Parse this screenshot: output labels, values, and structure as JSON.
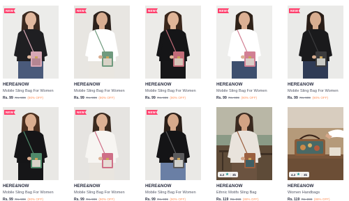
{
  "products": [
    {
      "badge": "NEW",
      "brand": "HERE&NOW",
      "title": "Mobile Sling Bag For Women",
      "price": "Rs. 99",
      "mrp": "Rs. 999",
      "off": "(90% OFF)",
      "scene": {
        "bg": "#ececea",
        "top": "#1f1f22",
        "skin": "#e2b99f",
        "hair": "#3b2a20",
        "bag": "#d7a7b5",
        "bag2": "#b58692",
        "bottom": "#4a5a7a"
      }
    },
    {
      "badge": "NEW",
      "brand": "HERE&NOW",
      "title": "Mobile Sling Bag For Women",
      "price": "Rs. 99",
      "mrp": "Rs. 999",
      "off": "(90% OFF)",
      "scene": {
        "bg": "#e8e6e2",
        "top": "#ffffff",
        "skin": "#d9ae92",
        "hair": "#2c211b",
        "bag": "#6f9a7e",
        "bag2": "#d8d2c6",
        "bottom": "#e9e6e0"
      }
    },
    {
      "badge": "NEW",
      "brand": "HERE&NOW",
      "title": "Mobile Sling Bag For Women",
      "price": "Rs. 99",
      "mrp": "Rs. 999",
      "off": "(90% OFF)",
      "scene": {
        "bg": "#ecebe8",
        "top": "#151517",
        "skin": "#e0b598",
        "hair": "#3a271c",
        "bag": "#c26b78",
        "bag2": "#d6c4b8",
        "bottom": "#161618"
      }
    },
    {
      "badge": "NEW",
      "brand": "HERE&NOW",
      "title": "Mobile Sling Bag For Women",
      "price": "Rs. 99",
      "mrp": "Rs. 999",
      "off": "(90% OFF)",
      "scene": {
        "bg": "#eeeeec",
        "top": "#ffffff",
        "skin": "#dcb094",
        "hair": "#2f2219",
        "bag": "#d27f93",
        "bag2": "#d9ccc6",
        "bottom": "#3d4f6e"
      }
    },
    {
      "badge": "NEW",
      "brand": "HERE&NOW",
      "title": "Mobile Sling Bag For Women",
      "price": "Rs. 99",
      "mrp": "Rs. 999",
      "off": "(90% OFF)",
      "scene": {
        "bg": "#eaeae8",
        "top": "#1a1a1c",
        "skin": "#d8ad90",
        "hair": "#2a1e18",
        "bag": "#3b3b3d",
        "bag2": "#c9c9c4",
        "bottom": "#2f3b55"
      }
    },
    {
      "badge": "NEW",
      "brand": "HERE&NOW",
      "title": "Mobile Sling Bag For Women",
      "price": "Rs. 99",
      "mrp": "Rs. 999",
      "off": "(90% OFF)",
      "scene": {
        "bg": "#e9e8e5",
        "top": "#151517",
        "skin": "#dcae90",
        "hair": "#4a2f1f",
        "bag": "#4f8a6a",
        "bag2": "#d8d2c8",
        "bottom": "#161618"
      }
    },
    {
      "badge": "NEW",
      "brand": "HERE&NOW",
      "title": "Mobile Sling Bag For Women",
      "price": "Rs. 99",
      "mrp": "Rs. 999",
      "off": "(90% OFF)",
      "scene": {
        "bg": "#e6e4e1",
        "top": "#f7f5f2",
        "skin": "#dcb094",
        "hair": "#3a2a20",
        "bag": "#cf6f87",
        "bag2": "#e8dcd6",
        "bottom": "#e9e5df"
      }
    },
    {
      "badge": "NEW",
      "brand": "HERE&NOW",
      "title": "Mobile Sling Bag For Women",
      "price": "Rs. 99",
      "mrp": "Rs. 999",
      "off": "(90% OFF)",
      "scene": {
        "bg": "#eae9e6",
        "top": "#141416",
        "skin": "#d6a98b",
        "hair": "#2b1f18",
        "bag": "#5a5a5c",
        "bag2": "#cfcfca",
        "bottom": "#6a7fa5"
      }
    },
    {
      "brand": "HERE&NOW",
      "title": "Ethnic Motifs Sling Bag",
      "price": "Rs. 119",
      "mrp": "Rs. 999",
      "off": "(88% OFF)",
      "rating": "4.2",
      "reviews": "3k",
      "scene": {
        "bg": "#8f7a60",
        "top": "#e9e3dc",
        "skin": "#d2a384",
        "hair": "#3a2a20",
        "bag": "#9a5f3f",
        "bag2": "#3f5e64",
        "bottom": "#6b5340",
        "outdoor": true
      }
    },
    {
      "brand": "HERE&NOW",
      "title": "Women Handbags",
      "price": "Rs. 119",
      "mrp": "Rs. 899",
      "off": "(86% OFF)",
      "rating": "4.2",
      "reviews": "3k",
      "scene": {
        "bg": "#a88c6c",
        "top": "#ffffff",
        "skin": "#d8a98a",
        "hair": "#3a2a20",
        "bag": "#8a5c3a",
        "bag2": "#3d6b6e",
        "bottom": "#5e4634",
        "table": true
      }
    }
  ]
}
